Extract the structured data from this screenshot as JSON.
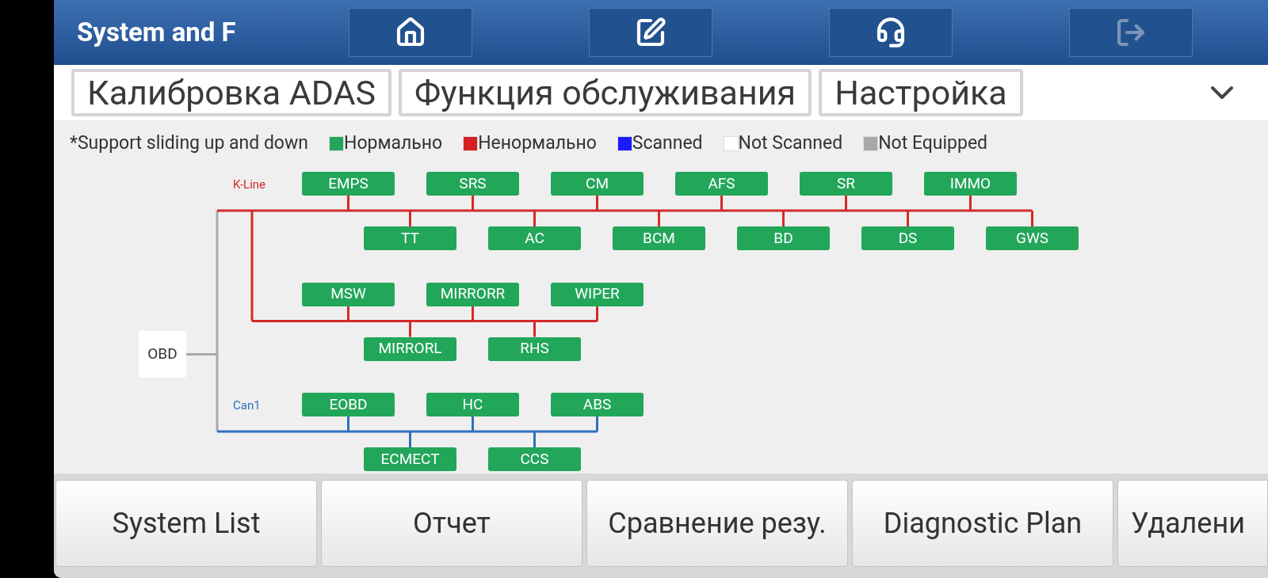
{
  "header": {
    "title": "System and F",
    "buttons": [
      {
        "kind": "home",
        "disabled": false
      },
      {
        "kind": "edit",
        "disabled": false
      },
      {
        "kind": "support",
        "disabled": false
      },
      {
        "kind": "exit",
        "disabled": true
      }
    ]
  },
  "tabs": [
    "Калибровка ADAS",
    "Функция обслуживания",
    "Настройка"
  ],
  "legend": {
    "note": "*Support sliding up and down",
    "items": [
      {
        "label": "Нормально",
        "color": "#22a65a"
      },
      {
        "label": "Ненормально",
        "color": "#d42020"
      },
      {
        "label": "Scanned",
        "color": "#1a1aff"
      },
      {
        "label": "Not Scanned",
        "color": "#ffffff"
      },
      {
        "label": "Not Equipped",
        "color": "#a8a8a8"
      }
    ]
  },
  "diagram": {
    "root": "OBD",
    "branches": [
      {
        "label": "K-Line",
        "kind": "k_line",
        "groups": [
          {
            "top": [
              {
                "name": "EMPS",
                "color": "#22a65a"
              },
              {
                "name": "SRS",
                "color": "#22a65a"
              },
              {
                "name": "CM",
                "color": "#22a65a"
              },
              {
                "name": "AFS",
                "color": "#22a65a"
              },
              {
                "name": "SR",
                "color": "#22a65a"
              },
              {
                "name": "IMMO",
                "color": "#22a65a"
              }
            ],
            "bottom": [
              {
                "name": "TT",
                "color": "#22a65a"
              },
              {
                "name": "AC",
                "color": "#22a65a"
              },
              {
                "name": "BCM",
                "color": "#22a65a"
              },
              {
                "name": "BD",
                "color": "#22a65a"
              },
              {
                "name": "DS",
                "color": "#22a65a"
              },
              {
                "name": "GWS",
                "color": "#22a65a"
              }
            ]
          },
          {
            "top": [
              {
                "name": "MSW",
                "color": "#22a65a"
              },
              {
                "name": "MIRRORR",
                "color": "#22a65a"
              },
              {
                "name": "WIPER",
                "color": "#22a65a"
              }
            ],
            "bottom": [
              {
                "name": "MIRRORL",
                "color": "#22a65a"
              },
              {
                "name": "RHS",
                "color": "#22a65a"
              }
            ]
          }
        ]
      },
      {
        "label": "Can1",
        "kind": "can",
        "groups": [
          {
            "top": [
              {
                "name": "EOBD",
                "color": "#22a65a"
              },
              {
                "name": "HC",
                "color": "#22a65a"
              },
              {
                "name": "ABS",
                "color": "#22a65a"
              }
            ],
            "bottom": [
              {
                "name": "ECMECT",
                "color": "#22a65a"
              },
              {
                "name": "CCS",
                "color": "#22a65a"
              }
            ]
          }
        ]
      }
    ]
  },
  "bottom_bar": [
    "System List",
    "Отчет",
    "Сравнение резу.",
    "Diagnostic Plan",
    "Удалени"
  ]
}
